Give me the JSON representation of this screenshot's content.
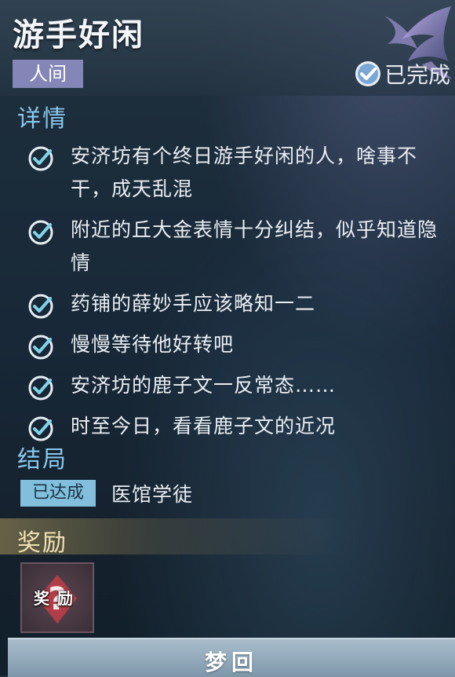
{
  "quest": {
    "title": "游手好闲",
    "tag": "人间",
    "status_label": "已完成"
  },
  "details": {
    "section_title": "详情",
    "tasks": [
      {
        "text": "安济坊有个终日游手好闲的人，啥事不干，成天乱混"
      },
      {
        "text": "附近的丘大金表情十分纠结，似乎知道隐情"
      },
      {
        "text": "药铺的薛妙手应该略知一二"
      },
      {
        "text": "慢慢等待他好转吧"
      },
      {
        "text": "安济坊的鹿子文一反常态……"
      },
      {
        "text": "时至今日，看看鹿子文的近况"
      }
    ]
  },
  "ending": {
    "section_title": "结局",
    "badge_label": "已达成",
    "name": "医馆学徒"
  },
  "reward": {
    "section_title": "奖励",
    "item_label": "奖励"
  },
  "action": {
    "dream_button_label": "梦回"
  },
  "colors": {
    "tag_bg": "#8386b6",
    "section_title": "#8ac8ec",
    "check": "#7fd3e8",
    "ending_badge_bg": "#82bfdc",
    "reward_title": "#f0e2b4",
    "reward_marker": "#d84848",
    "button_bg": "#9bb2c3"
  },
  "icons": {
    "task_check": "check-circle-icon",
    "completed": "check-badge-icon",
    "emblem": "winged-emblem-icon",
    "reward_marker": "question-mark-icon"
  }
}
